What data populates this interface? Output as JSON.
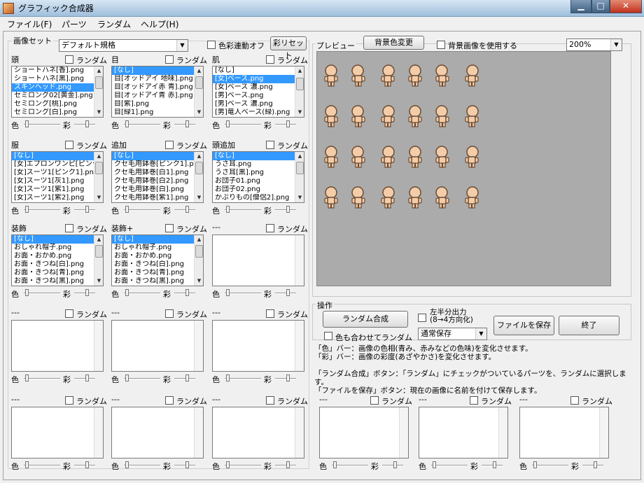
{
  "window": {
    "title": "グラフィック合成器",
    "min": "▁",
    "max": "□",
    "close": "✕"
  },
  "menu": [
    "ファイル(F)",
    "パーツ",
    "ランダム",
    "ヘルプ(H)"
  ],
  "imageset": {
    "label": "画像セット",
    "value": "デフォルト規格",
    "color_link": "色彩連動オフ",
    "reset": "彩リセット"
  },
  "common": {
    "random": "ランダム",
    "color": "色",
    "sat": "彩",
    "empty": "---"
  },
  "panels": {
    "head": {
      "label": "頭",
      "items": [
        "ショートハネ[香].png",
        "ショートハネ[黒].png",
        "スキンヘッド.png",
        "セミロング02[黄金].png",
        "セミロング[桃].png",
        "セミロング[白].png"
      ],
      "selected": 2
    },
    "eyes": {
      "label": "目",
      "items": [
        "[なし]",
        "目[オッドアイ 地味].png",
        "目[オッドアイ赤 青].png",
        "目[オッドアイ青 赤].png",
        "目[紫].png",
        "目[緑1].png"
      ],
      "selected": 0
    },
    "skin": {
      "label": "肌",
      "items": [
        "[なし]",
        "[女]ベース.png",
        "[女]ベース 濃.png",
        "[男]ベース.png",
        "[男]ベース 濃.png",
        "[男]竜人ベース(緑).png"
      ],
      "selected": 1
    },
    "clothes": {
      "label": "服",
      "items": [
        "[なし]",
        "[女]エプロンワンピ[ピンク].png",
        "[女]スーツ1[ピンク1].png",
        "[女]スーツ1[灰1].png",
        "[女]スーツ1[紫1].png",
        "[女]スーツ1[紫2].png"
      ],
      "selected": 0
    },
    "extra": {
      "label": "追加",
      "items": [
        "[なし]",
        "クセ毛用鉢巻[ピンク1].png",
        "クセ毛用鉢巻[白1].png",
        "クセ毛用鉢巻[白2].png",
        "クセ毛用鉢巻[白].png",
        "クセ毛用鉢巻[紫1].png"
      ],
      "selected": 0
    },
    "headextra": {
      "label": "頭追加",
      "items": [
        "[なし]",
        "うさ耳.png",
        "うさ耳[黒].png",
        "お団子01.png",
        "お団子02.png",
        "かぶりもの[僧侶2].png"
      ],
      "selected": 0
    },
    "accessory": {
      "label": "装飾",
      "items": [
        "[なし]",
        "おしゃれ帽子.png",
        "お面・おかめ.png",
        "お面・きつね[白].png",
        "お面・きつね[青].png",
        "お面・きつね[黒].png"
      ],
      "selected": 0
    },
    "accessoryplus": {
      "label": "装飾+",
      "items": [
        "[なし]",
        "おしゃれ帽子.png",
        "お面・おかめ.png",
        "お面・きつね[白].png",
        "お面・きつね[青].png",
        "お面・きつね[黒].png"
      ],
      "selected": 0
    }
  },
  "preview": {
    "label": "プレビュー",
    "bgcolor_btn": "背景色変更",
    "use_bg": "背景画像を使用する",
    "zoom": "200%",
    "bg": "#ababab"
  },
  "ops": {
    "label": "操作",
    "random_btn": "ランダム合成",
    "color_random": "色も合わせてランダム",
    "half_line1": "左半分出力",
    "half_line2": "(8→4方向化)",
    "save_mode": "通常保存",
    "save_btn": "ファイルを保存",
    "exit_btn": "終了"
  },
  "desc": [
    "「色」バー：画像の色相(青み、赤みなどの色味)を変化させます。",
    "「彩」バー：画像の彩度(あざやかさ)を変化させます。",
    "",
    "「ランダム合成」ボタン：「ランダム」にチェックがついているパーツを、ランダムに選択します。",
    "「ファイルを保存」ボタン：現在の画像に名前を付けて保存します。"
  ],
  "colors": {
    "selection": "#3399ff",
    "skin": "#f3cda9",
    "outline": "#6b4a32"
  }
}
